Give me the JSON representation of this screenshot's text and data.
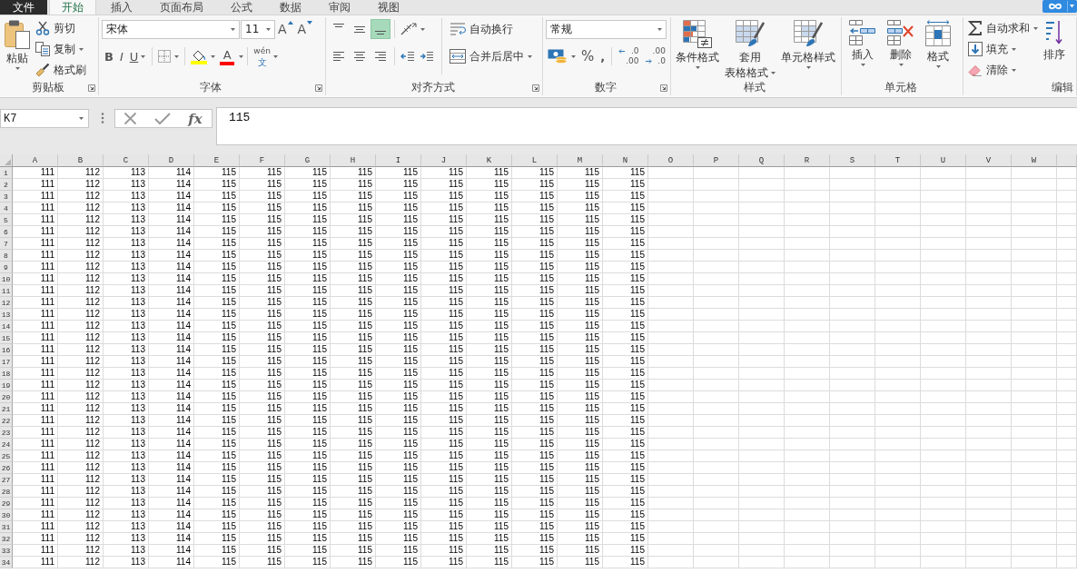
{
  "ribbon_tabs": [
    {
      "label": "文件",
      "kind": "file",
      "selected": false
    },
    {
      "label": "开始",
      "kind": "tab",
      "selected": true
    },
    {
      "label": "插入",
      "kind": "tab",
      "selected": false
    },
    {
      "label": "页面布局",
      "kind": "tab",
      "selected": false
    },
    {
      "label": "公式",
      "kind": "tab",
      "selected": false
    },
    {
      "label": "数据",
      "kind": "tab",
      "selected": false
    },
    {
      "label": "审阅",
      "kind": "tab",
      "selected": false
    },
    {
      "label": "视图",
      "kind": "tab",
      "selected": false
    }
  ],
  "clipboard": {
    "paste": "粘贴",
    "cut": "剪切",
    "copy": "复制",
    "format_painter": "格式刷",
    "label": "剪贴板"
  },
  "font": {
    "font_name": "宋体",
    "font_size": "11",
    "grow_font": "A",
    "shrink_font": "A",
    "bold": "B",
    "italic": "I",
    "underline": "U",
    "font_color": "A",
    "phonetic": [
      "wén",
      "文"
    ],
    "label": "字体"
  },
  "alignment": {
    "vertical": [
      {
        "kind": "top",
        "selected": false
      },
      {
        "kind": "middle",
        "selected": false
      },
      {
        "kind": "bottom",
        "selected": true
      }
    ],
    "horizontal": [
      {
        "kind": "left",
        "selected": false
      },
      {
        "kind": "center",
        "selected": false
      },
      {
        "kind": "right",
        "selected": false
      }
    ],
    "wrap_text": "自动换行",
    "merge_center": "合并后居中",
    "label": "对齐方式"
  },
  "number": {
    "format": "常规",
    "percent": "%",
    "comma": ",",
    "increase_decimal": [
      ".0",
      ".00"
    ],
    "decrease_decimal": [
      ".00",
      ".0"
    ],
    "label": "数字"
  },
  "styles": {
    "buttons": [
      {
        "kind": "conditional",
        "lines": [
          "条件格式"
        ]
      },
      {
        "kind": "table",
        "lines": [
          "套用",
          "表格格式"
        ]
      },
      {
        "kind": "cell",
        "lines": [
          "单元格样式"
        ]
      }
    ],
    "label": "样式"
  },
  "cells": {
    "buttons": [
      {
        "kind": "insert",
        "label": "插入"
      },
      {
        "kind": "delete",
        "label": "删除"
      },
      {
        "kind": "format",
        "label": "格式"
      }
    ],
    "label": "单元格"
  },
  "editing": {
    "autosum": "自动求和",
    "fill": "填充",
    "clear": "清除",
    "sort": "排序",
    "label": "编辑"
  },
  "formula_bar": {
    "name_box": "K7",
    "function_button": "fx",
    "formula": "115"
  },
  "sheet": {
    "columns": [
      "A",
      "B",
      "C",
      "D",
      "E",
      "F",
      "G",
      "H",
      "I",
      "J",
      "K",
      "L",
      "M",
      "N",
      "O",
      "P",
      "Q",
      "R",
      "S",
      "T",
      "U",
      "V",
      "W"
    ],
    "rows": [
      {
        "header": "1",
        "cells": [
          "111",
          "112",
          "113",
          "114",
          "115",
          "115",
          "115",
          "115",
          "115",
          "115",
          "115",
          "115",
          "115",
          "115"
        ]
      },
      {
        "header": "2",
        "cells": [
          "111",
          "112",
          "113",
          "114",
          "115",
          "115",
          "115",
          "115",
          "115",
          "115",
          "115",
          "115",
          "115",
          "115"
        ]
      },
      {
        "header": "3",
        "cells": [
          "111",
          "112",
          "113",
          "114",
          "115",
          "115",
          "115",
          "115",
          "115",
          "115",
          "115",
          "115",
          "115",
          "115"
        ]
      },
      {
        "header": "4",
        "cells": [
          "111",
          "112",
          "113",
          "114",
          "115",
          "115",
          "115",
          "115",
          "115",
          "115",
          "115",
          "115",
          "115",
          "115"
        ]
      },
      {
        "header": "5",
        "cells": [
          "111",
          "112",
          "113",
          "114",
          "115",
          "115",
          "115",
          "115",
          "115",
          "115",
          "115",
          "115",
          "115",
          "115"
        ]
      },
      {
        "header": "6",
        "cells": [
          "111",
          "112",
          "113",
          "114",
          "115",
          "115",
          "115",
          "115",
          "115",
          "115",
          "115",
          "115",
          "115",
          "115"
        ]
      },
      {
        "header": "7",
        "cells": [
          "111",
          "112",
          "113",
          "114",
          "115",
          "115",
          "115",
          "115",
          "115",
          "115",
          "115",
          "115",
          "115",
          "115"
        ]
      },
      {
        "header": "8",
        "cells": [
          "111",
          "112",
          "113",
          "114",
          "115",
          "115",
          "115",
          "115",
          "115",
          "115",
          "115",
          "115",
          "115",
          "115"
        ]
      },
      {
        "header": "9",
        "cells": [
          "111",
          "112",
          "113",
          "114",
          "115",
          "115",
          "115",
          "115",
          "115",
          "115",
          "115",
          "115",
          "115",
          "115"
        ]
      },
      {
        "header": "10",
        "cells": [
          "111",
          "112",
          "113",
          "114",
          "115",
          "115",
          "115",
          "115",
          "115",
          "115",
          "115",
          "115",
          "115",
          "115"
        ]
      },
      {
        "header": "11",
        "cells": [
          "111",
          "112",
          "113",
          "114",
          "115",
          "115",
          "115",
          "115",
          "115",
          "115",
          "115",
          "115",
          "115",
          "115"
        ]
      },
      {
        "header": "12",
        "cells": [
          "111",
          "112",
          "113",
          "114",
          "115",
          "115",
          "115",
          "115",
          "115",
          "115",
          "115",
          "115",
          "115",
          "115"
        ]
      },
      {
        "header": "13",
        "cells": [
          "111",
          "112",
          "113",
          "114",
          "115",
          "115",
          "115",
          "115",
          "115",
          "115",
          "115",
          "115",
          "115",
          "115"
        ]
      },
      {
        "header": "14",
        "cells": [
          "111",
          "112",
          "113",
          "114",
          "115",
          "115",
          "115",
          "115",
          "115",
          "115",
          "115",
          "115",
          "115",
          "115"
        ]
      },
      {
        "header": "15",
        "cells": [
          "111",
          "112",
          "113",
          "114",
          "115",
          "115",
          "115",
          "115",
          "115",
          "115",
          "115",
          "115",
          "115",
          "115"
        ]
      },
      {
        "header": "16",
        "cells": [
          "111",
          "112",
          "113",
          "114",
          "115",
          "115",
          "115",
          "115",
          "115",
          "115",
          "115",
          "115",
          "115",
          "115"
        ]
      },
      {
        "header": "17",
        "cells": [
          "111",
          "112",
          "113",
          "114",
          "115",
          "115",
          "115",
          "115",
          "115",
          "115",
          "115",
          "115",
          "115",
          "115"
        ]
      },
      {
        "header": "18",
        "cells": [
          "111",
          "112",
          "113",
          "114",
          "115",
          "115",
          "115",
          "115",
          "115",
          "115",
          "115",
          "115",
          "115",
          "115"
        ]
      },
      {
        "header": "19",
        "cells": [
          "111",
          "112",
          "113",
          "114",
          "115",
          "115",
          "115",
          "115",
          "115",
          "115",
          "115",
          "115",
          "115",
          "115"
        ]
      },
      {
        "header": "20",
        "cells": [
          "111",
          "112",
          "113",
          "114",
          "115",
          "115",
          "115",
          "115",
          "115",
          "115",
          "115",
          "115",
          "115",
          "115"
        ]
      },
      {
        "header": "21",
        "cells": [
          "111",
          "112",
          "113",
          "114",
          "115",
          "115",
          "115",
          "115",
          "115",
          "115",
          "115",
          "115",
          "115",
          "115"
        ]
      },
      {
        "header": "22",
        "cells": [
          "111",
          "112",
          "113",
          "114",
          "115",
          "115",
          "115",
          "115",
          "115",
          "115",
          "115",
          "115",
          "115",
          "115"
        ]
      },
      {
        "header": "23",
        "cells": [
          "111",
          "112",
          "113",
          "114",
          "115",
          "115",
          "115",
          "115",
          "115",
          "115",
          "115",
          "115",
          "115",
          "115"
        ]
      },
      {
        "header": "24",
        "cells": [
          "111",
          "112",
          "113",
          "114",
          "115",
          "115",
          "115",
          "115",
          "115",
          "115",
          "115",
          "115",
          "115",
          "115"
        ]
      },
      {
        "header": "25",
        "cells": [
          "111",
          "112",
          "113",
          "114",
          "115",
          "115",
          "115",
          "115",
          "115",
          "115",
          "115",
          "115",
          "115",
          "115"
        ]
      },
      {
        "header": "26",
        "cells": [
          "111",
          "112",
          "113",
          "114",
          "115",
          "115",
          "115",
          "115",
          "115",
          "115",
          "115",
          "115",
          "115",
          "115"
        ]
      },
      {
        "header": "27",
        "cells": [
          "111",
          "112",
          "113",
          "114",
          "115",
          "115",
          "115",
          "115",
          "115",
          "115",
          "115",
          "115",
          "115",
          "115"
        ]
      },
      {
        "header": "28",
        "cells": [
          "111",
          "112",
          "113",
          "114",
          "115",
          "115",
          "115",
          "115",
          "115",
          "115",
          "115",
          "115",
          "115",
          "115"
        ]
      },
      {
        "header": "29",
        "cells": [
          "111",
          "112",
          "113",
          "114",
          "115",
          "115",
          "115",
          "115",
          "115",
          "115",
          "115",
          "115",
          "115",
          "115"
        ]
      },
      {
        "header": "30",
        "cells": [
          "111",
          "112",
          "113",
          "114",
          "115",
          "115",
          "115",
          "115",
          "115",
          "115",
          "115",
          "115",
          "115",
          "115"
        ]
      },
      {
        "header": "31",
        "cells": [
          "111",
          "112",
          "113",
          "114",
          "115",
          "115",
          "115",
          "115",
          "115",
          "115",
          "115",
          "115",
          "115",
          "115"
        ]
      },
      {
        "header": "32",
        "cells": [
          "111",
          "112",
          "113",
          "114",
          "115",
          "115",
          "115",
          "115",
          "115",
          "115",
          "115",
          "115",
          "115",
          "115"
        ]
      },
      {
        "header": "33",
        "cells": [
          "111",
          "112",
          "113",
          "114",
          "115",
          "115",
          "115",
          "115",
          "115",
          "115",
          "115",
          "115",
          "115",
          "115"
        ]
      },
      {
        "header": "34",
        "cells": [
          "111",
          "112",
          "113",
          "114",
          "115",
          "115",
          "115",
          "115",
          "115",
          "115",
          "115",
          "115",
          "115",
          "115"
        ]
      }
    ]
  }
}
